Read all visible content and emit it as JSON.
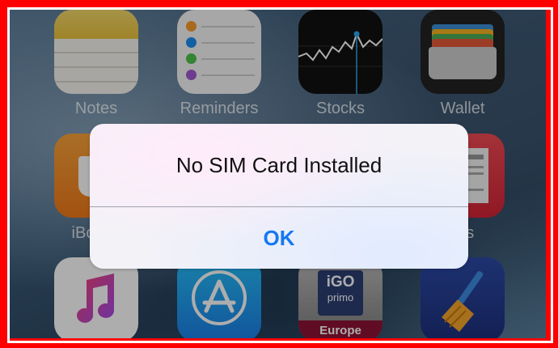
{
  "home_screen": {
    "apps": [
      {
        "label": "Notes",
        "icon": "notes-icon"
      },
      {
        "label": "Reminders",
        "icon": "reminders-icon"
      },
      {
        "label": "Stocks",
        "icon": "stocks-icon"
      },
      {
        "label": "Wallet",
        "icon": "wallet-icon"
      },
      {
        "label": "iBo",
        "icon": "ibooks-icon"
      },
      {
        "label": "ws",
        "icon": "news-icon"
      },
      {
        "label": "",
        "icon": "music-icon"
      },
      {
        "label": "",
        "icon": "app-store-icon"
      },
      {
        "label": "",
        "icon": "igo-primo-europe-icon",
        "text_top": "iGO",
        "text_mid": "primo",
        "text_bottom": "Europe"
      },
      {
        "label": "",
        "icon": "cleaner-broom-icon"
      }
    ]
  },
  "alert": {
    "title": "No SIM Card Installed",
    "button_label": "OK"
  },
  "colors": {
    "frame": "#ff0000",
    "alert_button": "#1478f2"
  }
}
